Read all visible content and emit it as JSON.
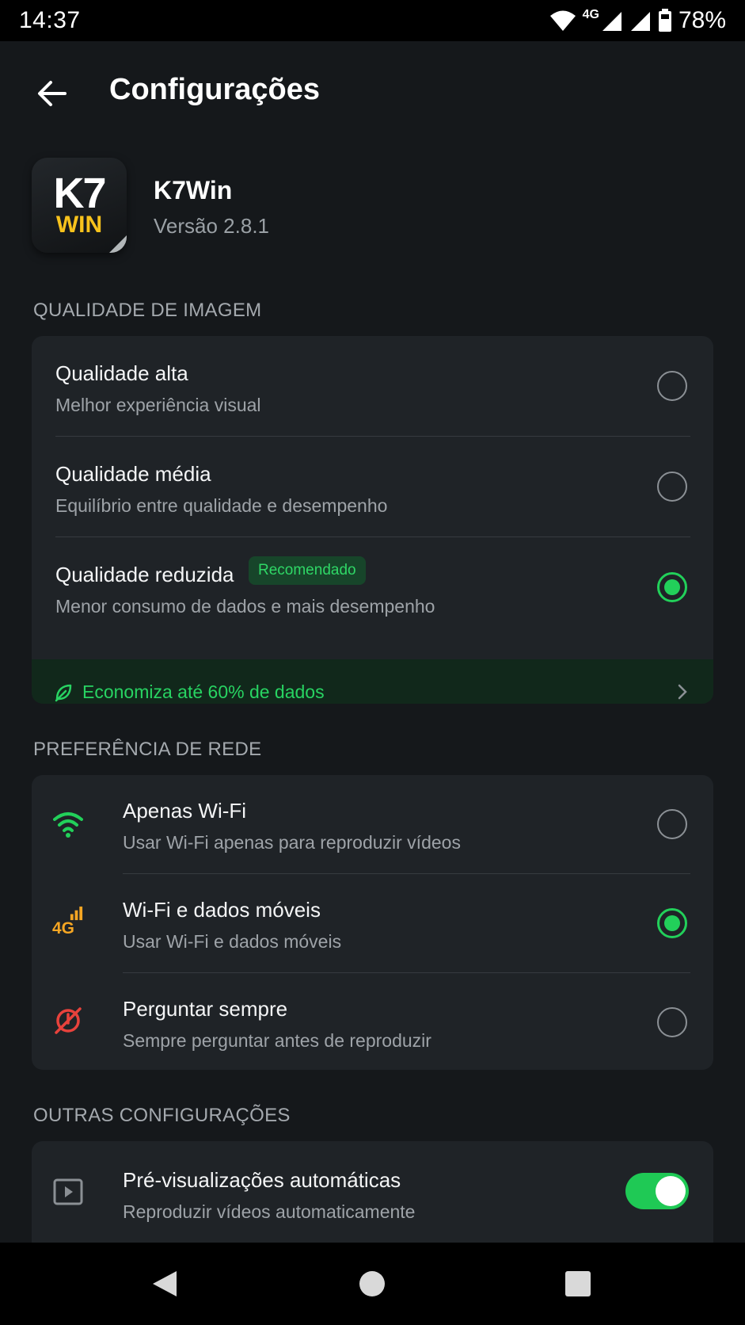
{
  "status_bar": {
    "time": "14:37",
    "network": "4G",
    "battery": "78%",
    "icons": [
      "wifi-icon",
      "signal-icon",
      "signal-icon",
      "battery-icon"
    ]
  },
  "header": {
    "title": "Configurações",
    "back_icon": "arrow-left-icon"
  },
  "app": {
    "logo_line1": "K7",
    "logo_line2": "WIN",
    "name": "K7Win",
    "version": "Versão 2.8.1"
  },
  "image_quality": {
    "section_label": "QUALIDADE DE IMAGEM",
    "options": [
      {
        "title": "Qualidade alta",
        "subtitle": "Melhor experiência visual",
        "selected": false
      },
      {
        "title": "Qualidade média",
        "subtitle": "Equilíbrio entre qualidade e desempenho",
        "selected": false
      },
      {
        "title": "Qualidade reduzida",
        "subtitle": "Menor consumo de dados e mais desempenho",
        "selected": true,
        "badge": "Recomendado"
      }
    ],
    "savings": {
      "icon": "leaf-icon",
      "text": "Economiza até 60% de dados",
      "chevron": "chevron-right-icon"
    }
  },
  "network_preference": {
    "section_label": "PREFERÊNCIA DE REDE",
    "options": [
      {
        "icon": "wifi-icon",
        "title": "Apenas Wi-Fi",
        "subtitle": "Usar Wi-Fi apenas para reproduzir vídeos",
        "selected": false
      },
      {
        "icon": "4g-icon",
        "icon_text": "4G",
        "title": "Wi-Fi e dados móveis",
        "subtitle": "Usar Wi-Fi e dados móveis",
        "selected": true
      },
      {
        "icon": "no-signal-icon",
        "title": "Perguntar sempre",
        "subtitle": "Sempre perguntar antes de reproduzir",
        "selected": false
      }
    ]
  },
  "other_settings": {
    "section_label": "OUTRAS CONFIGURAÇÕES",
    "items": [
      {
        "icon": "play-icon",
        "title": "Pré-visualizações automáticas",
        "subtitle": "Reproduzir vídeos automaticamente",
        "enabled": true
      }
    ]
  },
  "colors": {
    "accent": "#22d05a",
    "background": "#15181b",
    "card": "#1f2327",
    "logo_yellow": "#f7c21c",
    "warning_orange": "#f5a623",
    "danger_red": "#e8423c"
  },
  "nav_bar": {
    "icons": [
      "back-triangle-icon",
      "home-circle-icon",
      "recents-square-icon"
    ]
  }
}
